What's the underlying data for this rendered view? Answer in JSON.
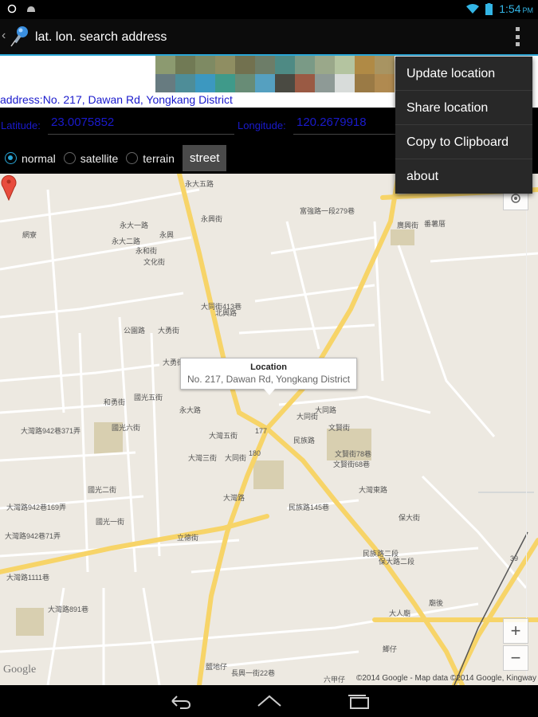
{
  "status_bar": {
    "time": "1:54",
    "ampm": "PM",
    "icons": [
      "notification-ring-icon",
      "android-debug-icon",
      "wifi-icon",
      "battery-icon"
    ]
  },
  "action_bar": {
    "title": "lat. lon. search address",
    "app_icon": "pushpin-icon",
    "overflow_icon": "overflow-menu-icon"
  },
  "swatch_colors": [
    "#8c9a70",
    "#717a55",
    "#7e8a63",
    "#8f8e62",
    "#72714f",
    "#6d7d68",
    "#4e8a84",
    "#7a9a86",
    "#9aa88a",
    "#b4c4a0",
    "#b08a45",
    "#a89462",
    "#677b80",
    "#4e8d98",
    "#3c98c0",
    "#3f9a8a",
    "#688c76",
    "#55a0c0",
    "#4a4a42",
    "#9a5a44",
    "#8e9a96",
    "#d8dcda",
    "#9a7a45",
    "#b08a50"
  ],
  "address": {
    "label": "address:",
    "value": "No. 217, Dawan Rd, Yongkang District"
  },
  "coords": {
    "lat_label": "Latitude:",
    "lat_value": "23.0075852",
    "lon_label": "Longitude:",
    "lon_value": "120.2679918"
  },
  "map_types": {
    "options": [
      "normal",
      "satellite",
      "terrain"
    ],
    "selected": "normal",
    "street_button": "street"
  },
  "map": {
    "callout_title": "Location",
    "callout_subtitle": "No. 217, Dawan Rd, Yongkang District",
    "google_logo": "Google",
    "copyright": "©2014 Google - Map data ©2014 Google, Kingway",
    "zoom_in": "+",
    "zoom_out": "−",
    "labels": [
      "永大五路",
      "永興街",
      "永大一路",
      "永大二路",
      "永和街",
      "文化街",
      "永興",
      "大同街413巷",
      "北興路",
      "大同街",
      "公園路",
      "大勇街",
      "國光五街",
      "國光六街",
      "國光二街",
      "國光一街",
      "永大路",
      "大灣五街",
      "大灣三街",
      "大灣路",
      "民族路",
      "文賢街",
      "大同街",
      "180",
      "177",
      "富強路一段279巷",
      "廣興街",
      "番薯厝",
      "網寮",
      "大灣路942巷371弄",
      "大灣路942巷169弄",
      "大灣路942巷71弄",
      "大灣東路",
      "民族路二段",
      "保大街",
      "保大路二段",
      "大人廟",
      "廟後",
      "鹽地仔",
      "長興一街22巷",
      "鯽仔",
      "大灣路1111巷",
      "大灣路891巷",
      "文賢街78巷",
      "文賢街68巷",
      "民族路145巷",
      "立德街",
      "和勇街",
      "大勇街",
      "大同路",
      "39",
      "六甲仔"
    ]
  },
  "overflow_menu": {
    "items": [
      "Update location",
      "Share location",
      "Copy to Clipboard",
      "about"
    ]
  },
  "nav_bar": {
    "icons": [
      "back-icon",
      "home-icon",
      "recent-apps-icon"
    ]
  }
}
